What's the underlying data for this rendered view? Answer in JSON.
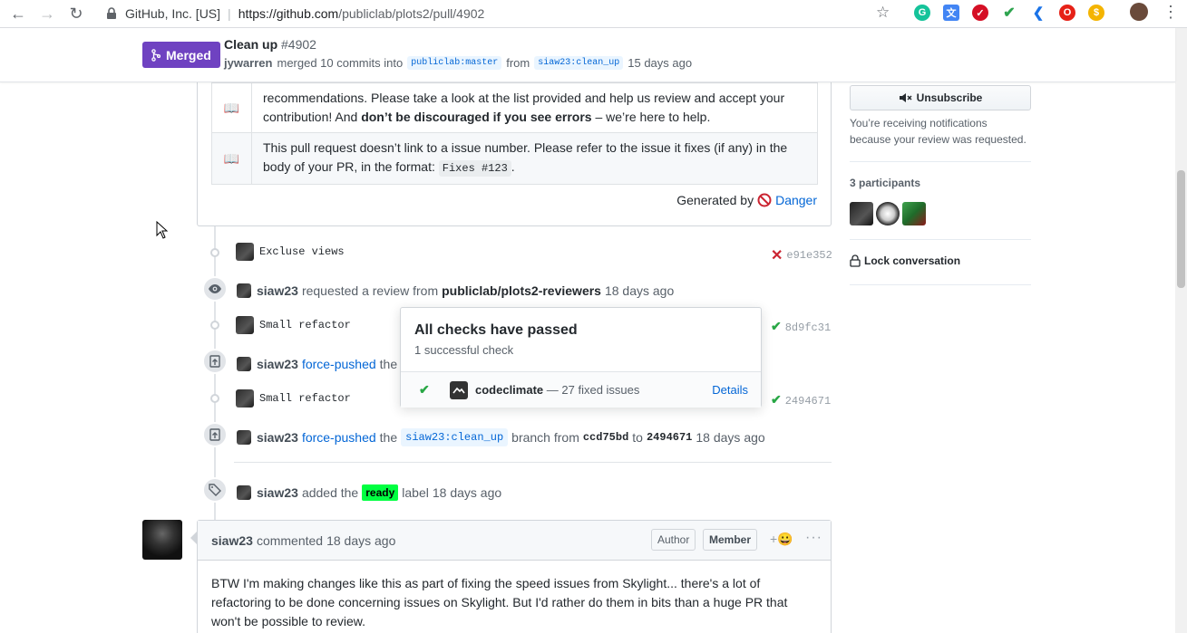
{
  "browser": {
    "site_name": "GitHub, Inc. [US]",
    "url_host": "https://github.com",
    "url_path": "/publiclab/plots2/pull/4902"
  },
  "pr": {
    "status": "Merged",
    "title": "Clean up",
    "number": "#4902",
    "merger": "jywarren",
    "merged_text": "merged 10 commits into",
    "base_branch": "publiclab:master",
    "from_text": "from",
    "head_branch": "siaw23:clean_up",
    "age": "15 days ago"
  },
  "danger": {
    "row1_icon": "📖",
    "row1_text_a": "recommendations. Please take a look at the list provided and help us review and accept your contribution! And ",
    "row1_bold": "don’t be discouraged if you see errors",
    "row1_text_b": " – we’re here to help.",
    "row2_icon": "📖",
    "row2_text_a": "This pull request doesn’t link to a issue number. Please refer to the issue it fixes (if any) in the body of your PR, in the format: ",
    "row2_code": "Fixes #123",
    "row2_text_b": ".",
    "generated_by": "Generated by",
    "danger_link": "Danger"
  },
  "timeline": {
    "commit1": {
      "message": "Excluse views",
      "sha": "e91e352",
      "status": "failure"
    },
    "review_request": {
      "user": "siaw23",
      "text": "requested a review from",
      "team": "publiclab/plots2-reviewers",
      "age": "18 days ago"
    },
    "commit2": {
      "message": "Small refactor",
      "sha": "8d9fc31",
      "status": "success"
    },
    "force_push1": {
      "user": "siaw23",
      "action": "force-pushed",
      "text": "the"
    },
    "commit3": {
      "message": "Small refactor",
      "sha": "2494671",
      "status": "success"
    },
    "force_push2": {
      "user": "siaw23",
      "action": "force-pushed",
      "text_the": "the",
      "branch": "siaw23:clean_up",
      "text_from": "branch from",
      "from_sha": "ccd75bd",
      "text_to": "to",
      "to_sha": "2494671",
      "age": "18 days ago"
    },
    "label_event": {
      "user": "siaw23",
      "text_added": "added the",
      "label": "ready",
      "text_label": "label",
      "age": "18 days ago"
    }
  },
  "popover": {
    "title": "All checks have passed",
    "subtitle": "1 successful check",
    "check_name": "codeclimate",
    "check_desc": "— 27 fixed issues",
    "details": "Details"
  },
  "comment": {
    "author": "siaw23",
    "action": "commented",
    "age": "18 days ago",
    "role_author": "Author",
    "role_member": "Member",
    "reaction_icon": "+😀",
    "more": "···",
    "body": "BTW I'm making changes like this as part of fixing the speed issues from Skylight... there's a lot of refactoring to be done concerning issues on Skylight. But I'd rather do them in bits than a huge PR that won't be possible to review."
  },
  "sidebar": {
    "unsubscribe": "Unsubscribe",
    "notification_text": "You’re receiving notifications because your review was requested.",
    "participants_title": "3 participants",
    "lock_conversation": "Lock conversation"
  },
  "colors": {
    "merged_purple": "#6f42c1",
    "link_blue": "#0366d6",
    "success_green": "#28a745",
    "failure_red": "#cb2431",
    "ready_label": "#00ff41"
  }
}
